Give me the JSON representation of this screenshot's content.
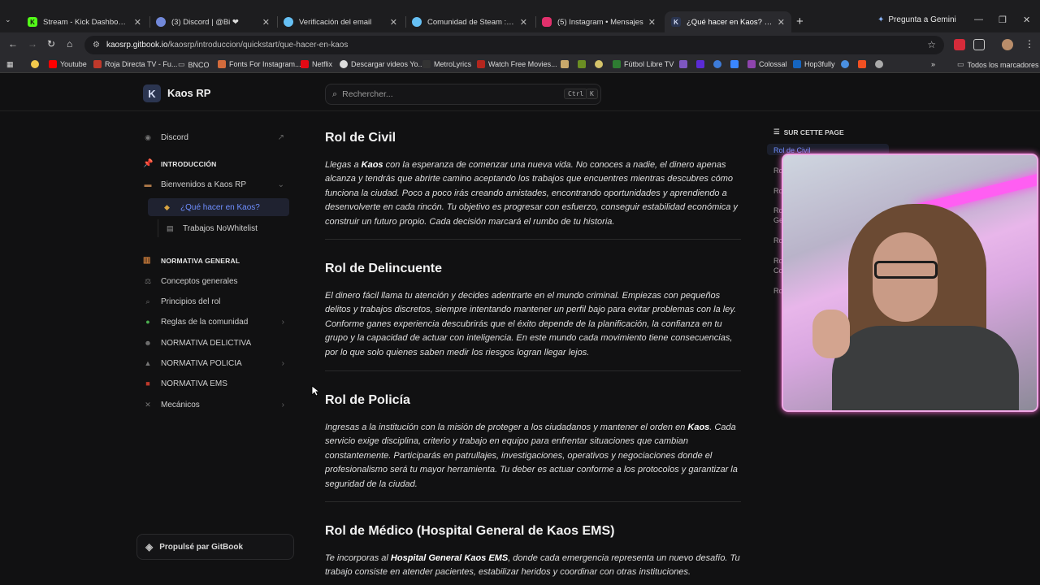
{
  "browser": {
    "tabs": [
      {
        "title": "Stream - Kick Dashboard",
        "icon": "kick-icon",
        "color": "#53fc18"
      },
      {
        "title": "(3) Discord | @Bi ❤",
        "icon": "discord-icon",
        "color": "#7289da"
      },
      {
        "title": "Verificación del email",
        "icon": "steam-icon",
        "color": "#66c0f4"
      },
      {
        "title": "Comunidad de Steam :: giselm...",
        "icon": "steam-icon",
        "color": "#66c0f4"
      },
      {
        "title": "(5) Instagram • Mensajes",
        "icon": "instagram-icon",
        "color": "#e1306c"
      },
      {
        "title": "¿Qué hacer en Kaos? | Kaos RP",
        "icon": "kaos-icon",
        "color": "#2b3550"
      }
    ],
    "gemini_label": "Pregunta a Gemini",
    "url_host": "kaosrp.gitbook.io",
    "url_path": "/kaosrp/introduccion/quickstart/que-hacer-en-kaos",
    "bookmarks": [
      "Youtube",
      "Roja Directa TV - Fu...",
      "BNCO",
      "Fonts For Instagram...",
      "Netflix",
      "Descargar videos Yo...",
      "MetroLyrics",
      "Watch Free Movies...",
      "Fútbol Libre TV",
      "Colossal",
      "Hop3fully"
    ],
    "all_bookmarks": "Todos los marcadores"
  },
  "site": {
    "logo_letter": "K",
    "name": "Kaos RP",
    "search_placeholder": "Rechercher...",
    "kbd_ctrl": "Ctrl",
    "kbd_k": "K"
  },
  "sidebar": {
    "discord": "Discord",
    "intro_section": "INTRODUCCIÓN",
    "welcome": "Bienvenidos a Kaos RP",
    "what_to_do": "¿Qué hacer en Kaos?",
    "nowhitelist": "Trabajos NoWhitelist",
    "normativa_section": "NORMATIVA GENERAL",
    "items": [
      {
        "label": "Conceptos generales",
        "chevron": false
      },
      {
        "label": "Principios del rol",
        "chevron": false
      },
      {
        "label": "Reglas de la comunidad",
        "chevron": true
      },
      {
        "label": "NORMATIVA DELICTIVA",
        "chevron": false
      },
      {
        "label": "NORMATIVA POLICIA",
        "chevron": true
      },
      {
        "label": "NORMATIVA EMS",
        "chevron": false
      },
      {
        "label": "Mecánicos",
        "chevron": true
      }
    ],
    "powered_by": "Propulsé par GitBook"
  },
  "content": {
    "civil_title": "Rol de Civil",
    "civil_pre": "Llegas a ",
    "civil_bold": "Kaos",
    "civil_post": " con la esperanza de comenzar una nueva vida. No conoces a nadie, el dinero apenas alcanza y tendrás que abrirte camino aceptando los trabajos que encuentres mientras descubres cómo funciona la ciudad. Poco a poco irás creando amistades, encontrando oportunidades y aprendiendo a desenvolverte en cada rincón. Tu objetivo es progresar con esfuerzo, conseguir estabilidad económica y construir un futuro propio. Cada decisión marcará el rumbo de tu historia.",
    "delin_title": "Rol de Delincuente",
    "delin_text": "El dinero fácil llama tu atención y decides adentrarte en el mundo criminal. Empiezas con pequeños delitos y trabajos discretos, siempre intentando mantener un perfil bajo para evitar problemas con la ley. Conforme ganes experiencia descubrirás que el éxito depende de la planificación, la confianza en tu grupo y la capacidad de actuar con inteligencia. En este mundo cada movimiento tiene consecuencias, por lo que solo quienes saben medir los riesgos logran llegar lejos.",
    "police_title": "Rol de Policía",
    "police_pre": "Ingresas a la institución con la misión de proteger a los ciudadanos y mantener el orden en ",
    "police_bold": "Kaos",
    "police_post": ". Cada servicio exige disciplina, criterio y trabajo en equipo para enfrentar situaciones que cambian constantemente. Participarás en patrullajes, investigaciones, operativos y negociaciones donde el profesionalismo será tu mayor herramienta. Tu deber es actuar conforme a los protocolos y garantizar la seguridad de la ciudad.",
    "medic_title": "Rol de Médico (Hospital General de Kaos EMS)",
    "medic_pre": "Te incorporas al ",
    "medic_bold": "Hospital General Kaos EMS",
    "medic_post": ", donde cada emergencia representa un nuevo desafío. Tu trabajo consiste en atender pacientes, estabilizar heridos y coordinar con otras instituciones."
  },
  "toc": {
    "title": "SUR CETTE PAGE",
    "items": [
      "Rol de Civil",
      "Ro",
      "Ro",
      "Ro",
      "Ge",
      "Ro",
      "Ro",
      "Co",
      "Ro"
    ]
  }
}
